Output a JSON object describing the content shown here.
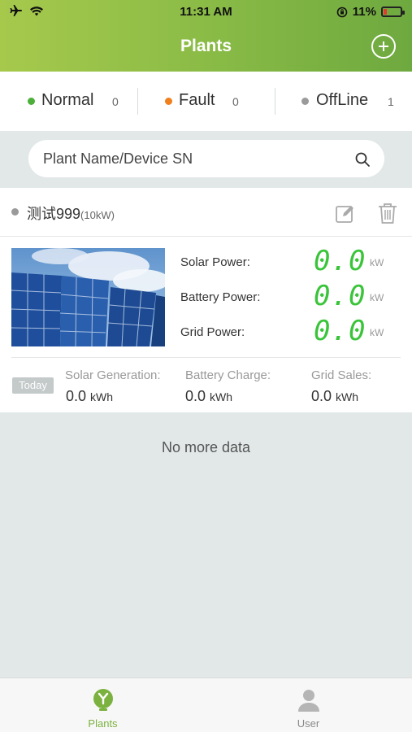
{
  "status_bar": {
    "time": "11:31 AM",
    "battery": "11%"
  },
  "header": {
    "title": "Plants"
  },
  "filters": [
    {
      "label": "Normal",
      "count": "0",
      "color": "#4caf3a"
    },
    {
      "label": "Fault",
      "count": "0",
      "color": "#f07f1e"
    },
    {
      "label": "OffLine",
      "count": "1",
      "color": "#9a9a9a"
    }
  ],
  "search": {
    "placeholder": "Plant Name/Device SN"
  },
  "plant": {
    "name": "测试999",
    "capacity": "(10kW)",
    "metrics": [
      {
        "label": "Solar Power:",
        "value": "0.0",
        "unit": "kW"
      },
      {
        "label": "Battery Power:",
        "value": "0.0",
        "unit": "kW"
      },
      {
        "label": "Grid Power:",
        "value": "0.0",
        "unit": "kW"
      }
    ],
    "today_label": "Today",
    "stats": [
      {
        "label": "Solar Generation:",
        "value": "0.0",
        "unit": "kWh"
      },
      {
        "label": "Battery Charge:",
        "value": "0.0",
        "unit": "kWh"
      },
      {
        "label": "Grid Sales:",
        "value": "0.0",
        "unit": "kWh"
      }
    ]
  },
  "list_footer": "No more data",
  "tabbar": {
    "tabs": [
      {
        "label": "Plants",
        "icon": "plant-icon",
        "active": true,
        "color": "#7bb23f"
      },
      {
        "label": "User",
        "icon": "user-icon",
        "active": false,
        "color": "#888888"
      }
    ]
  }
}
